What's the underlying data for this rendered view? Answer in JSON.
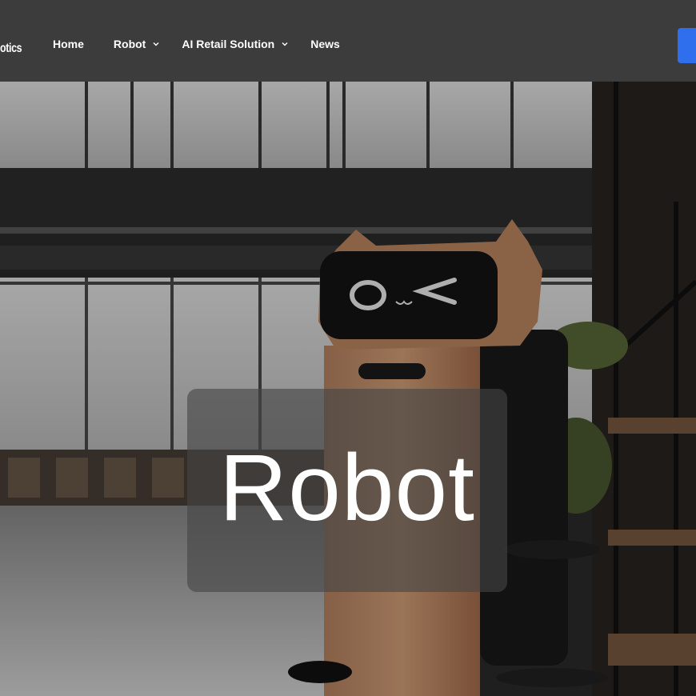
{
  "header": {
    "logo_text": "otics",
    "nav": {
      "home": "Home",
      "robot": "Robot",
      "ai_retail": "AI Retail Solution",
      "news": "News"
    },
    "cta_color": "#2f6fed"
  },
  "hero": {
    "title": "Robot",
    "background_description_icon": "robot-cat-photo",
    "robot_face": "O ω <"
  },
  "icons": {
    "caret": "chevron-down-icon"
  },
  "colors": {
    "header_bg": "#3c3c3c",
    "accent": "#2f6fed",
    "robot_body": "#c9936a"
  }
}
